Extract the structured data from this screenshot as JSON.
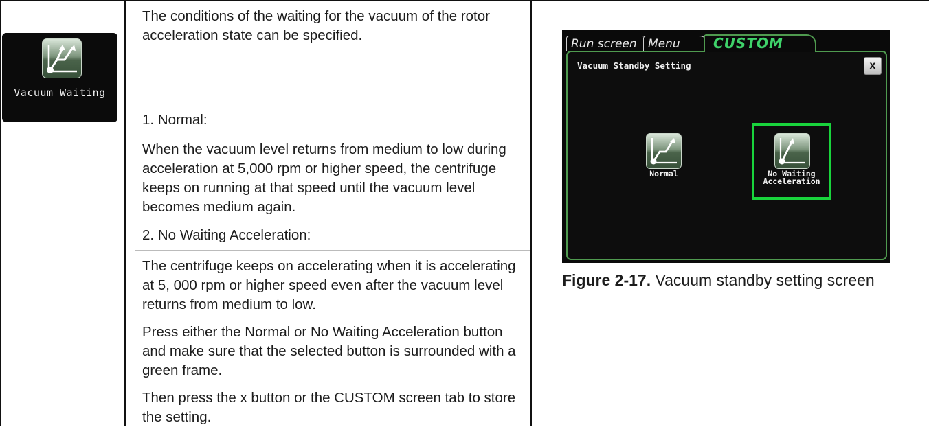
{
  "left_cell": {
    "icon_name": "vacuum-waiting-icon",
    "label": "Vacuum Waiting"
  },
  "description": {
    "intro": "The conditions of the waiting for the vacuum of the rotor acceleration state can be specified.",
    "normal_heading": "1. Normal:",
    "normal_text": "When the vacuum level returns from medium to low during acceleration at 5,000 rpm or higher speed, the centrifuge keeps on running at that speed until the vacuum level becomes medium again.",
    "nowait_heading": "2. No Waiting Acceleration:",
    "nowait_text": "The centrifuge keeps on accelerating when it is accelerating at 5, 000 rpm or higher speed even after the vacuum level returns from medium to low.",
    "press_text": "Press either the Normal or No Waiting Acceleration button and make sure that the selected button is surrounded with a green frame.",
    "store_text": "Then press the x button or the CUSTOM screen tab to store the setting."
  },
  "device_screen": {
    "tabs": [
      "Run screen",
      "Menu",
      "CUSTOM"
    ],
    "active_tab": "CUSTOM",
    "panel_title": "Vacuum Standby Setting",
    "close_label": "x",
    "options": [
      {
        "label_line1": "Normal",
        "label_line2": "",
        "selected": false
      },
      {
        "label_line1": "No Waiting",
        "label_line2": "Acceleration",
        "selected": true
      }
    ],
    "selection_color": "#19d43c"
  },
  "figure": {
    "number": "Figure 2-17.",
    "caption": "Vacuum standby setting screen"
  }
}
